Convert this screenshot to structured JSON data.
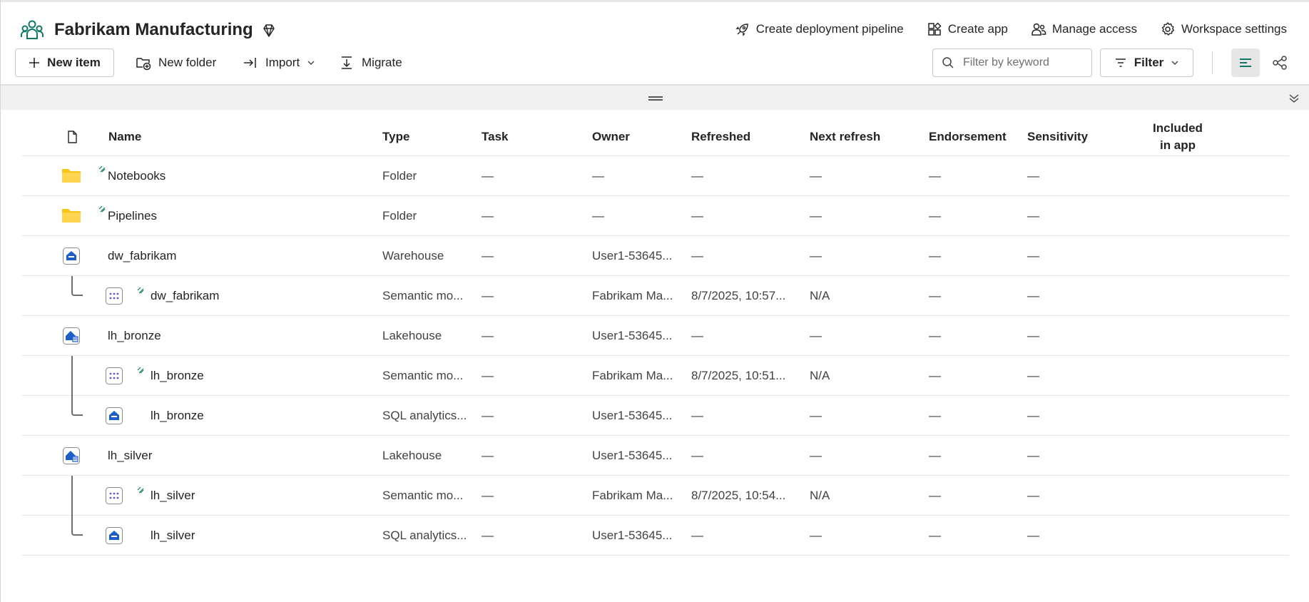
{
  "workspace": {
    "title": "Fabrikam Manufacturing",
    "icon": "workspace-people-icon",
    "accent": "#117865"
  },
  "header_actions": [
    {
      "label": "Create deployment pipeline",
      "icon": "rocket-icon"
    },
    {
      "label": "Create app",
      "icon": "app-grid-icon"
    },
    {
      "label": "Manage access",
      "icon": "people-icon"
    },
    {
      "label": "Workspace settings",
      "icon": "gear-icon"
    }
  ],
  "toolbar": {
    "new_item": "New item",
    "new_folder": "New folder",
    "import": "Import",
    "migrate": "Migrate",
    "search_placeholder": "Filter by keyword",
    "filter": "Filter"
  },
  "columns": {
    "name": "Name",
    "type": "Type",
    "task": "Task",
    "owner": "Owner",
    "refreshed": "Refreshed",
    "next_refresh": "Next refresh",
    "endorsement": "Endorsement",
    "sensitivity": "Sensitivity",
    "included_line1": "Included",
    "included_line2": "in app"
  },
  "rows": [
    {
      "name": "Notebooks",
      "type": "Folder",
      "task": "—",
      "owner": "—",
      "refreshed": "—",
      "next_refresh": "—",
      "endorsement": "—",
      "sensitivity": "—",
      "icon": "folder-icon",
      "child": false
    },
    {
      "name": "Pipelines",
      "type": "Folder",
      "task": "—",
      "owner": "—",
      "refreshed": "—",
      "next_refresh": "—",
      "endorsement": "—",
      "sensitivity": "—",
      "icon": "folder-icon",
      "child": false
    },
    {
      "name": "dw_fabrikam",
      "type": "Warehouse",
      "task": "—",
      "owner": "User1-53645...",
      "refreshed": "—",
      "next_refresh": "—",
      "endorsement": "—",
      "sensitivity": "—",
      "icon": "warehouse-icon",
      "child": false
    },
    {
      "name": "dw_fabrikam",
      "type": "Semantic mo...",
      "task": "—",
      "owner": "Fabrikam Ma...",
      "refreshed": "8/7/2025, 10:57...",
      "next_refresh": "N/A",
      "endorsement": "—",
      "sensitivity": "—",
      "icon": "semantic-model-icon",
      "child": true
    },
    {
      "name": "lh_bronze",
      "type": "Lakehouse",
      "task": "—",
      "owner": "User1-53645...",
      "refreshed": "—",
      "next_refresh": "—",
      "endorsement": "—",
      "sensitivity": "—",
      "icon": "lakehouse-icon",
      "child": false
    },
    {
      "name": "lh_bronze",
      "type": "Semantic mo...",
      "task": "—",
      "owner": "Fabrikam Ma...",
      "refreshed": "8/7/2025, 10:51...",
      "next_refresh": "N/A",
      "endorsement": "—",
      "sensitivity": "—",
      "icon": "semantic-model-icon",
      "child": true
    },
    {
      "name": "lh_bronze",
      "type": "SQL analytics...",
      "task": "—",
      "owner": "User1-53645...",
      "refreshed": "—",
      "next_refresh": "—",
      "endorsement": "—",
      "sensitivity": "—",
      "icon": "sql-endpoint-icon",
      "child": true
    },
    {
      "name": "lh_silver",
      "type": "Lakehouse",
      "task": "—",
      "owner": "User1-53645...",
      "refreshed": "—",
      "next_refresh": "—",
      "endorsement": "—",
      "sensitivity": "—",
      "icon": "lakehouse-icon",
      "child": false
    },
    {
      "name": "lh_silver",
      "type": "Semantic mo...",
      "task": "—",
      "owner": "Fabrikam Ma...",
      "refreshed": "8/7/2025, 10:54...",
      "next_refresh": "N/A",
      "endorsement": "—",
      "sensitivity": "—",
      "icon": "semantic-model-icon",
      "child": true
    },
    {
      "name": "lh_silver",
      "type": "SQL analytics...",
      "task": "—",
      "owner": "User1-53645...",
      "refreshed": "—",
      "next_refresh": "—",
      "endorsement": "—",
      "sensitivity": "—",
      "icon": "sql-endpoint-icon",
      "child": true
    }
  ]
}
